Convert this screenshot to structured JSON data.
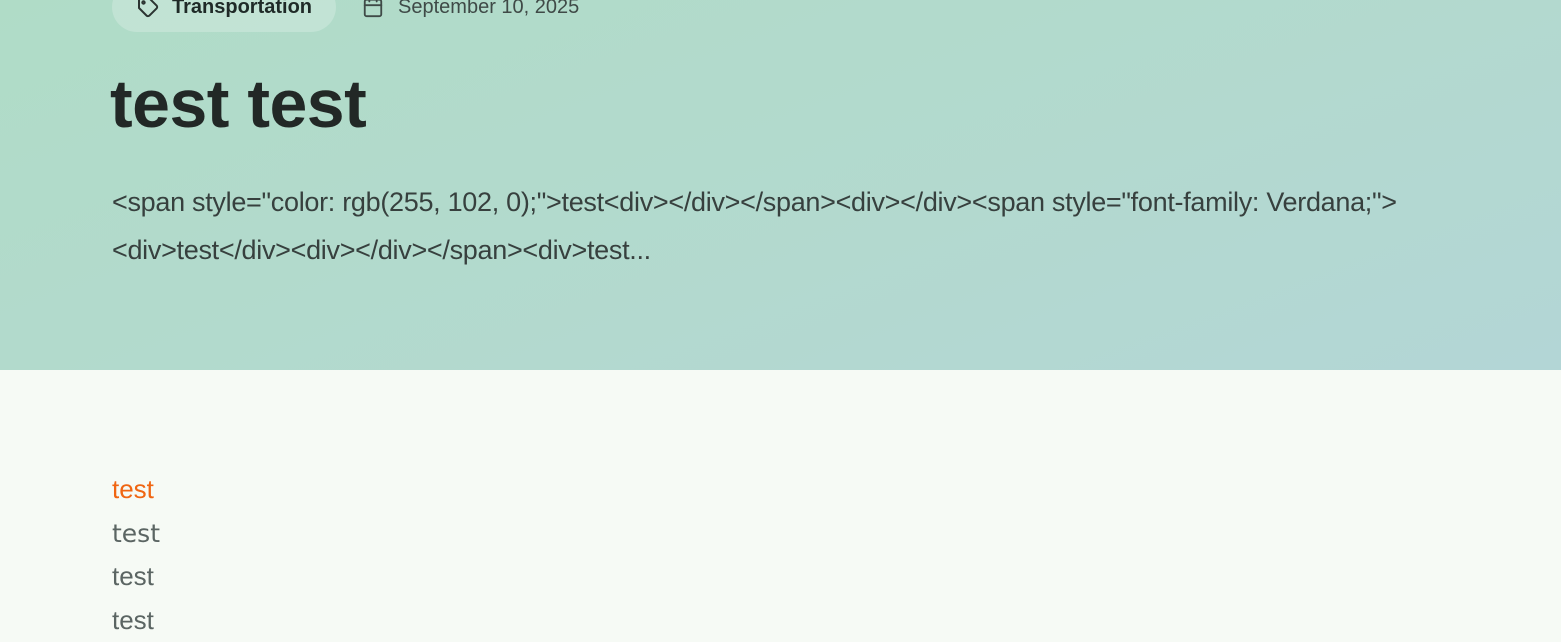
{
  "post": {
    "category": "Transportation",
    "date": "September 10, 2025",
    "title": "test test",
    "excerpt": "<span style=\"color: rgb(255, 102, 0);\">test<div></div></span><div></div><span style=\"font-family: Verdana;\"><div>test</div><div></div></span><div>test..."
  },
  "body": {
    "lines": [
      "test",
      "test",
      "test",
      "test"
    ]
  },
  "colors": {
    "hero_gradient_start": "#b0dcc7",
    "hero_gradient_end": "#b3d6d6",
    "content_background": "#f6faf5",
    "highlight_text": "#f06512",
    "title_text": "#222826"
  },
  "icons": {
    "category": "tag-icon",
    "date": "calendar-icon"
  }
}
